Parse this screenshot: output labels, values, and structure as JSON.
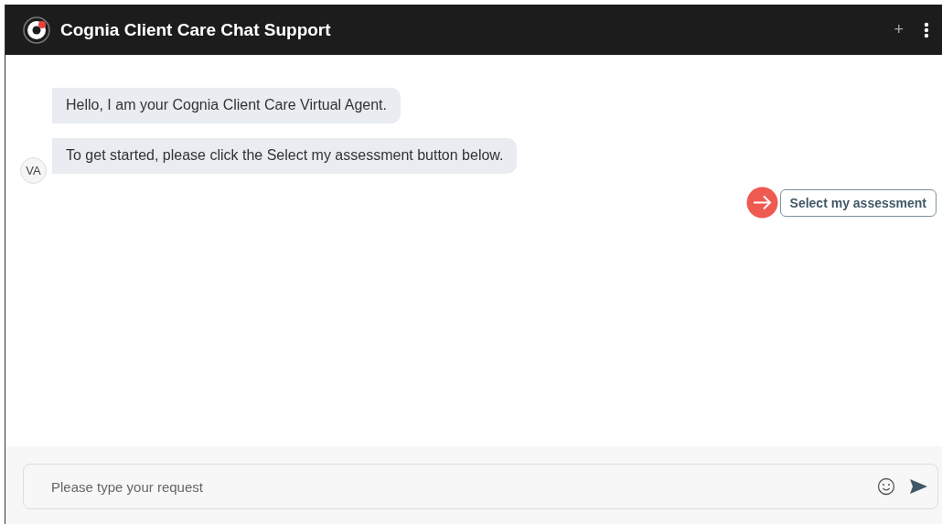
{
  "header": {
    "title": "Cognia Client Care Chat Support",
    "actions": [
      {
        "kind": "add",
        "label": "+"
      },
      {
        "kind": "menu"
      }
    ]
  },
  "messages": [
    {
      "text": "Hello, I am your Cognia Client Care Virtual Agent."
    },
    {
      "text": "To get started, please click the Select my assessment button below.",
      "avatar": "VA"
    }
  ],
  "quick_reply": {
    "label": "Select my assessment"
  },
  "composer": {
    "placeholder": "Please type your request"
  }
}
